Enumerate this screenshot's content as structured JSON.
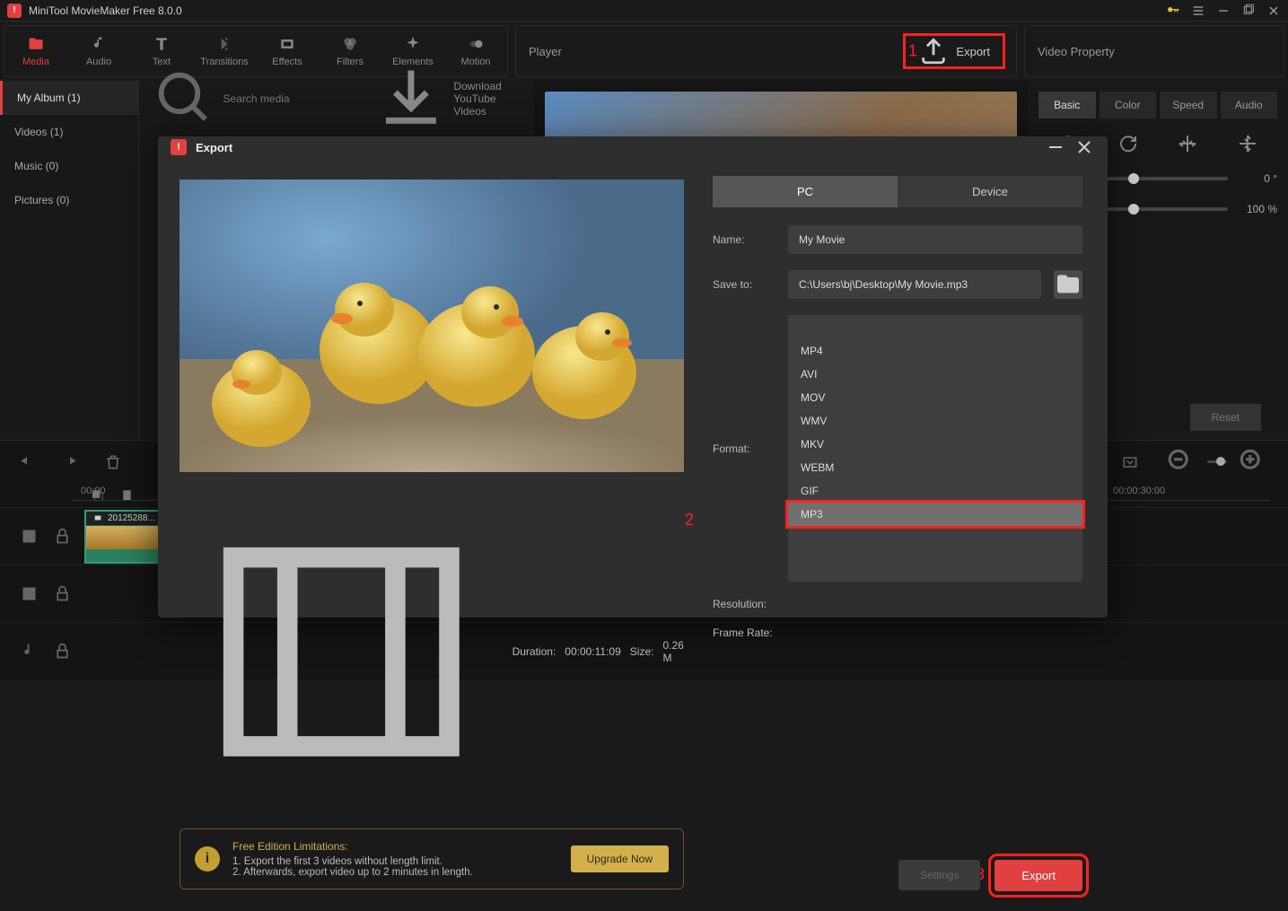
{
  "app": {
    "title": "MiniTool MovieMaker Free 8.0.0"
  },
  "toolbar": {
    "items": [
      {
        "label": "Media"
      },
      {
        "label": "Audio"
      },
      {
        "label": "Text"
      },
      {
        "label": "Transitions"
      },
      {
        "label": "Effects"
      },
      {
        "label": "Filters"
      },
      {
        "label": "Elements"
      },
      {
        "label": "Motion"
      }
    ],
    "player_label": "Player",
    "export_label": "Export",
    "video_property_label": "Video Property"
  },
  "sidebar": {
    "items": [
      {
        "label": "My Album (1)"
      },
      {
        "label": "Videos (1)"
      },
      {
        "label": "Music (0)"
      },
      {
        "label": "Pictures (0)"
      }
    ]
  },
  "search": {
    "placeholder": "Search media",
    "download_label": "Download YouTube Videos"
  },
  "props": {
    "tabs": [
      "Basic",
      "Color",
      "Speed",
      "Audio"
    ],
    "rotation_value": "0 °",
    "zoom_value": "100 %",
    "reset_label": "Reset"
  },
  "timeline": {
    "start_time": "00:00",
    "end_time": "00:00:30:00",
    "clip_name": "20125288..."
  },
  "modal": {
    "title": "Export",
    "tabs": {
      "pc": "PC",
      "device": "Device"
    },
    "fields": {
      "name_label": "Name:",
      "name_value": "My Movie",
      "saveto_label": "Save to:",
      "saveto_value": "C:\\Users\\bj\\Desktop\\My Movie.mp3",
      "format_label": "Format:",
      "format_value": "MP3",
      "resolution_label": "Resolution:",
      "framerate_label": "Frame Rate:"
    },
    "format_options": [
      "MP4",
      "AVI",
      "MOV",
      "WMV",
      "MKV",
      "WEBM",
      "GIF",
      "MP3"
    ],
    "info": {
      "duration_label": "Duration:",
      "duration_value": "00:00:11:09",
      "size_label": "Size:",
      "size_value": "0.26 M"
    },
    "note": {
      "title": "Free Edition Limitations:",
      "line1": "1. Export the first 3 videos without length limit.",
      "line2": "2. Afterwards, export video up to 2 minutes in length.",
      "upgrade": "Upgrade Now"
    },
    "actions": {
      "settings": "Settings",
      "export": "Export"
    }
  },
  "annotations": {
    "a1": "1",
    "a2": "2",
    "a3": "3"
  }
}
